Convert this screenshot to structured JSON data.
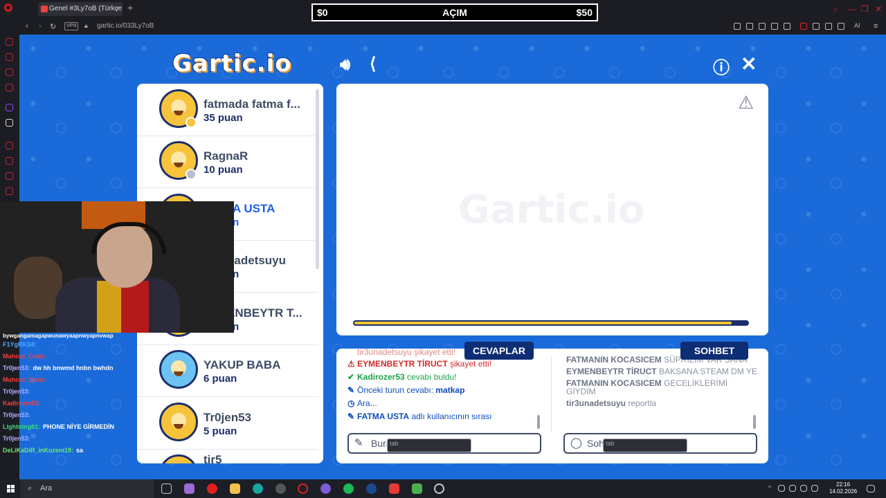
{
  "browser": {
    "tab_title": "Genel #3Ly7oB (Türkçe) -",
    "url": "gartic.io/033Ly7oB",
    "vpn_label": "VPN",
    "ai_label": "AI"
  },
  "overlay": {
    "left": "$0",
    "center": "AÇIM",
    "right": "$50"
  },
  "game": {
    "logo": "Gartic.io",
    "watermark": "Gartic.io",
    "timer_fraction": 0.96,
    "players": [
      {
        "name": "fatmada fatma f...",
        "score": "35 puan",
        "status": "drawing",
        "status_color": "#f6c33a",
        "avatar": "yellow"
      },
      {
        "name": "RagnaR",
        "score": "10 puan",
        "status": "away",
        "status_color": "#b9bec8",
        "avatar": "yellow"
      },
      {
        "name": "A USTA",
        "score": "n",
        "avatar": "yellow",
        "highlight": true
      },
      {
        "name": "nadetsuyu",
        "score": "n",
        "avatar": "yellow"
      },
      {
        "name": "ENBEYTR T...",
        "score": "n",
        "avatar": "yellow"
      },
      {
        "name": "YAKUP BABA",
        "score": "6 puan",
        "avatar": "blue"
      },
      {
        "name": "Tr0jen53",
        "score": "5 puan",
        "avatar": "yellow"
      },
      {
        "name": "tir5",
        "score": "",
        "avatar": "yellow"
      }
    ],
    "tabs": {
      "answers": "CEVAPLAR",
      "chat": "SOHBET"
    },
    "answers": [
      {
        "icon": "",
        "text": "tir3unadetsuyu şikayet etti!",
        "color": "red"
      },
      {
        "icon": "⚠",
        "user": "EYMENBEYTR TİRUCT",
        "text": " şikayet etti!",
        "color": "red"
      },
      {
        "icon": "✔",
        "user": "Kadirozer53",
        "text": " cevabı buldu!",
        "color": "green"
      },
      {
        "icon": "✎",
        "text": "Önceki turun cevabı: ",
        "user2": "matkap",
        "color": "blue"
      },
      {
        "icon": "◷",
        "text": "Ara...",
        "color": "blue"
      },
      {
        "icon": "✎",
        "user": "FATMA USTA",
        "text": " adlı kullanıcının sırası",
        "color": "blue"
      }
    ],
    "chat": [
      {
        "user": "FATMANIN KOCASICEM",
        "text": " SÜPRİZİM VAR SANA"
      },
      {
        "user": "EYMENBEYTR TİRUCT",
        "text": " BAKSANA STEAM DM YE"
      },
      {
        "user": "FATMANIN KOCASICEM",
        "text": " GECELİKLERİMİ GİYDİM"
      },
      {
        "user": "tir3unadetsuyu",
        "text": " reportla"
      }
    ],
    "answer_placeholder": "Buraya cevaplayın...",
    "chat_placeholder": "Sohbet...",
    "tab_key": "tab"
  },
  "stream_chat": [
    {
      "user": "bywgangamagapwunawyaapnwyapnvwap",
      "text": ""
    },
    {
      "user": "F1YgRKS8:",
      "text": ""
    },
    {
      "user": "Mahout_Celio:",
      "text": ""
    },
    {
      "user": "Tr0jen53:",
      "text": "dw hh bnwmd hnbn bwhdn"
    },
    {
      "user": "Mahout_Celio:",
      "text": ""
    },
    {
      "user": "Tr0jen53:",
      "text": ""
    },
    {
      "user": "Kadirozer53:",
      "text": ""
    },
    {
      "user": "Tr0jen53:",
      "text": ""
    },
    {
      "user": "Lightning61:",
      "text": "PHONE NİYE GİRMEDİN"
    },
    {
      "user": "Tr0jen53:",
      "text": ""
    },
    {
      "user": "DeLiKaDiR_inKuzeni19:",
      "text": "sa"
    }
  ],
  "taskbar": {
    "search": "Ara",
    "time": "22:16",
    "date": "14.02.2026"
  }
}
